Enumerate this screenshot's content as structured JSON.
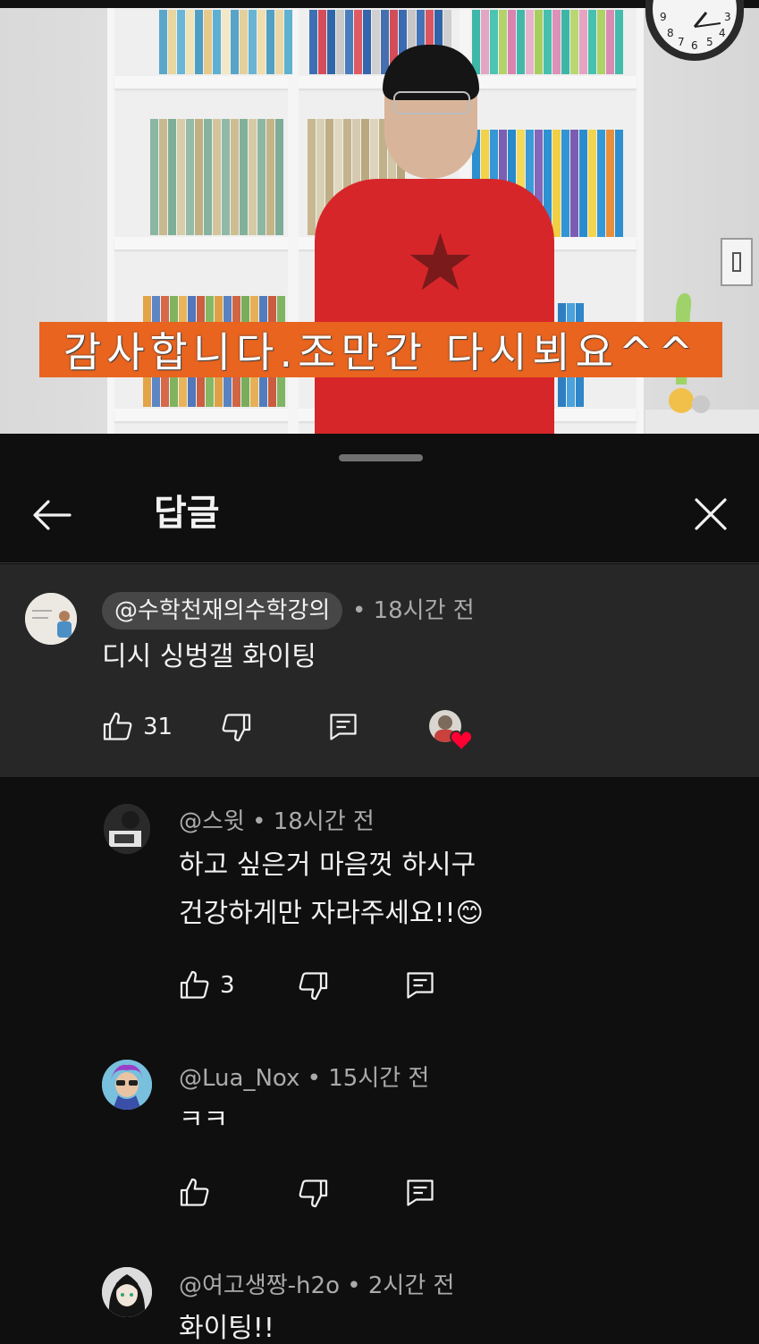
{
  "video": {
    "subtitle": "감사합니다.조만간 다시뵈요^^",
    "clock_digits": [
      "9",
      "8",
      "7",
      "6",
      "5",
      "4",
      "3"
    ]
  },
  "panel": {
    "title": "답글",
    "back_icon": "arrow-left-icon",
    "close_icon": "close-icon"
  },
  "parent_comment": {
    "author": "@수학천재의수학강의",
    "time": "• 18시간 전",
    "text": "디시 싱벙갤 화이팅",
    "likes": "31",
    "creator_heart": true
  },
  "replies": [
    {
      "author_time": "@스윗 • 18시간 전",
      "lines": [
        "하고 싶은거 마음껏 하시구",
        "건강하게만 자라주세요!!"
      ],
      "emoji": "😊",
      "likes": "3"
    },
    {
      "author_time": "@Lua_Nox • 15시간 전",
      "lines": [
        "ㅋㅋ"
      ],
      "likes": ""
    },
    {
      "author_time": "@여고생짱-h2o • 2시간 전",
      "lines": [
        "화이팅!!"
      ],
      "likes": ""
    }
  ],
  "colors": {
    "background": "#0f0f0f",
    "highlight_row": "#272727",
    "chip": "#474747",
    "caption_bar": "#e8641f",
    "heart": "#ff0033"
  }
}
